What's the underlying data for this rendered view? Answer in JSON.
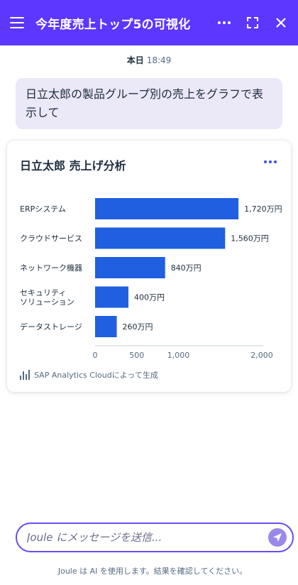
{
  "header": {
    "title": "今年度売上トップ5の可視化",
    "more_icon": "more-horizontal-icon",
    "fullscreen_icon": "fullscreen-icon",
    "close_icon": "close-icon",
    "menu_icon": "hamburger-menu-icon"
  },
  "conversation": {
    "timestamp_day": "本日",
    "timestamp_time": "18:49",
    "user_message": "日立太郎の製品グループ別の売上をグラフで表示して"
  },
  "card": {
    "title": "日立太郎 売上げ分析",
    "footer_text": "SAP Analytics Cloudによって生成"
  },
  "chart_data": {
    "type": "bar",
    "orientation": "horizontal",
    "title": "日立太郎 売上げ分析",
    "categories": [
      "ERPシステム",
      "クラウドサービス",
      "ネットワーク機器",
      "セキュリティ\nソリューション",
      "データストレージ"
    ],
    "category_lines": [
      [
        "ERPシステム"
      ],
      [
        "クラウドサービス"
      ],
      [
        "ネットワーク機器"
      ],
      [
        "セキュリティ",
        "ソリューション"
      ],
      [
        "データストレージ"
      ]
    ],
    "values": [
      1720,
      1560,
      840,
      400,
      260
    ],
    "data_labels": [
      "1,720万円",
      "1,560万円",
      "840万円",
      "400万円",
      "260万円"
    ],
    "x_ticks": [
      0,
      500,
      1000,
      2000
    ],
    "x_tick_labels": [
      "0",
      "500",
      "1,000",
      "2,000"
    ],
    "xlim": [
      0,
      2000
    ],
    "bar_color": "#1f5fe0",
    "grid": false,
    "legend": "none"
  },
  "input": {
    "placeholder": "Joule にメッセージを送信...",
    "value": ""
  },
  "disclaimer": "Joule は AI を使用します。結果を確認してください。",
  "colors": {
    "header": "#5d36ff",
    "accent": "#6b4cf0",
    "send_button": "#9c88ea",
    "user_bubble": "#ebe8f7"
  }
}
